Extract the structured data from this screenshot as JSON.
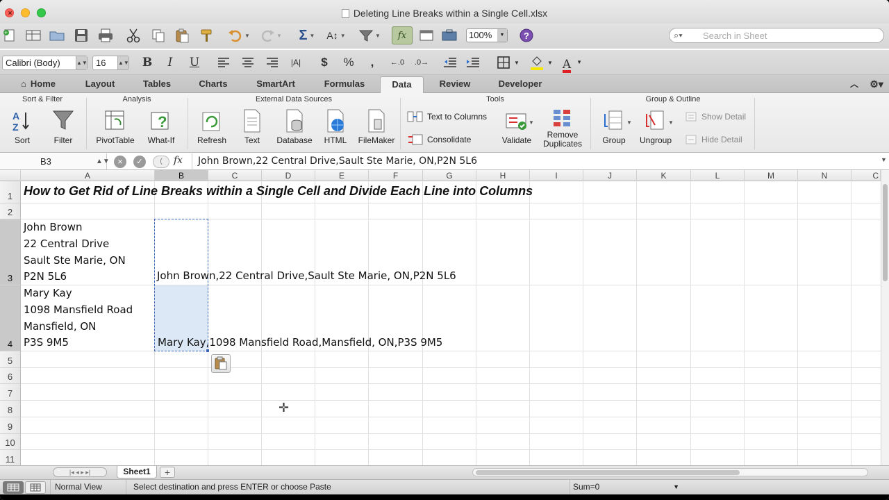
{
  "window": {
    "title": "Deleting Line Breaks within a Single Cell.xlsx"
  },
  "toolbar": {
    "zoom": "100%",
    "search_placeholder": "Search in Sheet"
  },
  "format": {
    "font_name": "Calibri (Body)",
    "font_size": "16"
  },
  "tabs": [
    "Home",
    "Layout",
    "Tables",
    "Charts",
    "SmartArt",
    "Formulas",
    "Data",
    "Review",
    "Developer"
  ],
  "active_tab": "Data",
  "ribbon": {
    "groups": {
      "sort_filter": "Sort & Filter",
      "analysis": "Analysis",
      "external": "External Data Sources",
      "tools": "Tools",
      "group_outline": "Group & Outline"
    },
    "buttons": {
      "sort": "Sort",
      "filter": "Filter",
      "pivot": "PivotTable",
      "whatif": "What-If",
      "refresh": "Refresh",
      "text": "Text",
      "database": "Database",
      "html": "HTML",
      "filemaker": "FileMaker",
      "text_to_columns": "Text to Columns",
      "consolidate": "Consolidate",
      "validate": "Validate",
      "remove_dup_1": "Remove",
      "remove_dup_2": "Duplicates",
      "group": "Group",
      "ungroup": "Ungroup",
      "show_detail": "Show Detail",
      "hide_detail": "Hide Detail"
    }
  },
  "formula_bar": {
    "name_box": "B3",
    "fx": "fx",
    "formula": "John Brown,22 Central Drive,Sault Ste Marie, ON,P2N 5L6"
  },
  "columns": [
    "A",
    "B",
    "C",
    "D",
    "E",
    "F",
    "G",
    "H",
    "I",
    "J",
    "K",
    "L",
    "M",
    "N",
    "C"
  ],
  "rows": [
    "1",
    "2",
    "3",
    "4",
    "5",
    "6",
    "7",
    "8",
    "9",
    "10",
    "11"
  ],
  "cells": {
    "A1": "How to Get Rid of Line Breaks within a Single Cell and Divide Each Line into Columns",
    "A3": [
      "John Brown",
      "22 Central Drive",
      "Sault Ste Marie, ON",
      "P2N 5L6"
    ],
    "B3": "John Brown,22 Central Drive,Sault Ste Marie, ON,P2N 5L6",
    "A4": [
      "Mary Kay",
      "1098 Mansfield Road",
      "Mansfield, ON",
      "P3S 9M5"
    ],
    "B4": "Mary Kay,1098 Mansfield Road,Mansfield, ON,P3S 9M5"
  },
  "sheet_tabs": [
    "Sheet1"
  ],
  "status": {
    "view": "Normal View",
    "message": "Select destination and press ENTER or choose Paste",
    "sum": "Sum=0"
  },
  "colors": {
    "accent_selection": "#dde8f7",
    "active_tab_bg": "#f4f4f4"
  }
}
